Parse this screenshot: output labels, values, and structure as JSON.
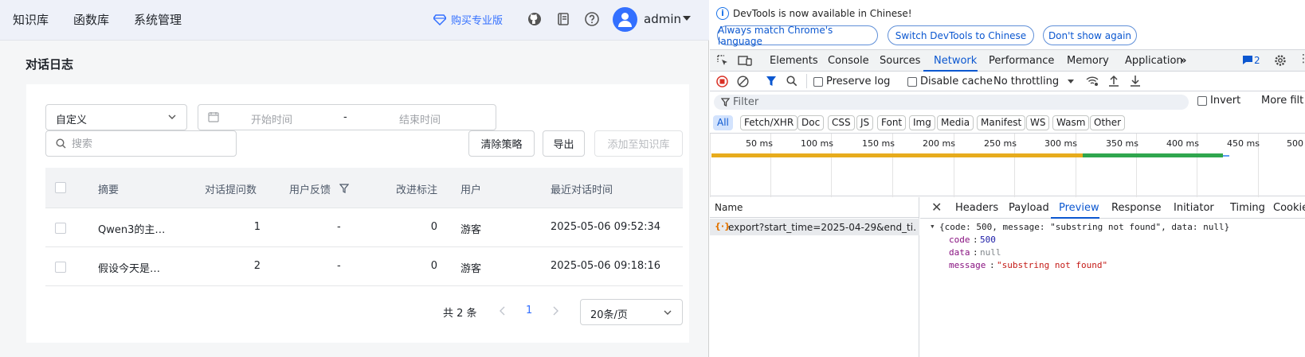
{
  "nav": {
    "items": [
      "知识库",
      "函数库",
      "系统管理"
    ],
    "buy_pro": "购买专业版",
    "username": "admin"
  },
  "page": {
    "title": "对话日志"
  },
  "filters": {
    "range_value": "自定义",
    "start_placeholder": "开始时间",
    "separator": "-",
    "end_placeholder": "结束时间",
    "search_placeholder": "搜索"
  },
  "actions": {
    "clear": "清除策略",
    "export": "导出",
    "add_to_kb": "添加至知识库"
  },
  "table": {
    "headers": {
      "summary": "摘要",
      "question_count": "对话提问数",
      "feedback": "用户反馈",
      "improve": "改进标注",
      "user": "用户",
      "last_time": "最近对话时间"
    },
    "rows": [
      {
        "summary": "Qwen3的主…",
        "question_count": "1",
        "feedback": "-",
        "improve": "0",
        "user": "游客",
        "last_time": "2025-05-06 09:52:34"
      },
      {
        "summary": "假设今天是…",
        "question_count": "2",
        "feedback": "-",
        "improve": "0",
        "user": "游客",
        "last_time": "2025-05-06 09:18:16"
      }
    ]
  },
  "pagination": {
    "total": "共 2 条",
    "current": "1",
    "page_size": "20条/页"
  },
  "devtools": {
    "info": "DevTools is now available in Chinese!",
    "pill_match": "Always match Chrome's language",
    "pill_switch": "Switch DevTools to Chinese",
    "pill_dont": "Don't show again",
    "tabs": [
      "Elements",
      "Console",
      "Sources",
      "Network",
      "Performance",
      "Memory",
      "Application"
    ],
    "issues_count": "2",
    "preserve_log": "Preserve log",
    "disable_cache": "Disable cache",
    "throttling": "No throttling",
    "filter_placeholder": "Filter",
    "invert": "Invert",
    "more_filters": "More filt",
    "types": [
      "All",
      "Fetch/XHR",
      "Doc",
      "CSS",
      "JS",
      "Font",
      "Img",
      "Media",
      "Manifest",
      "WS",
      "Wasm",
      "Other"
    ],
    "timeline_labels": [
      "50 ms",
      "100 ms",
      "150 ms",
      "200 ms",
      "250 ms",
      "300 ms",
      "350 ms",
      "400 ms",
      "450 ms",
      "500"
    ],
    "name_header": "Name",
    "request_name": "export?start_time=2025-04-29&end_ti…",
    "detail_tabs": [
      "Headers",
      "Payload",
      "Preview",
      "Response",
      "Initiator",
      "Timing",
      "Cookie"
    ],
    "preview": {
      "summary": "{code: 500, message: \"substring not found\", data: null}",
      "code_key": "code",
      "code_val": "500",
      "data_key": "data",
      "data_val": "null",
      "message_key": "message",
      "message_val": "\"substring not found\""
    }
  }
}
